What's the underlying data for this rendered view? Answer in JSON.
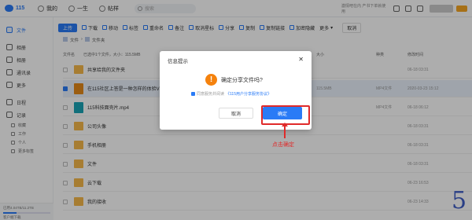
{
  "header": {
    "logo_text": "115",
    "nav": [
      "我的",
      "一生",
      "帖样"
    ],
    "search_placeholder": "搜索",
    "promo_text": "激情吧在内 产书下单就使用"
  },
  "sidebar": {
    "items": [
      {
        "label": "文件",
        "icon": "folder-icon",
        "active": true
      },
      {
        "label": "相册",
        "icon": "photo-icon"
      },
      {
        "label": "相册",
        "icon": "image-icon"
      },
      {
        "label": "通讯录",
        "icon": "contacts-icon"
      },
      {
        "label": "更多",
        "icon": "more-icon"
      },
      {
        "label": "日程",
        "icon": "calendar-icon"
      },
      {
        "label": "记录",
        "icon": "note-icon"
      }
    ],
    "subs": [
      "收藏",
      "工作",
      "个人",
      "更多标签"
    ],
    "footer_storage": "已用4.04TB/11.2TB",
    "footer_link": "客户端下载"
  },
  "toolbar": {
    "upload": "上传",
    "actions": [
      "下载",
      "移动",
      "标签",
      "重命名",
      "备注",
      "取消星标",
      "分享",
      "复制",
      "复制链接",
      "加密隐藏",
      "更多"
    ],
    "cancel": "取消"
  },
  "breadcrumb": {
    "root": "文件",
    "current": "文件夹"
  },
  "table": {
    "headers": {
      "name": "文件名",
      "selected": "已选中1个文件，大小：115.5MB",
      "size": "大小",
      "type": "种类",
      "time": "修改时间"
    },
    "rows": [
      {
        "name": "共享给我的文件夹",
        "kind": "folder",
        "size": "",
        "type": "",
        "time": "06-18 03:31"
      },
      {
        "name": "在115社区上答是一种怎样的体验V2.0",
        "kind": "video",
        "size": "115.5MB",
        "type": "MP4文件",
        "time": "2020-03-23 15:12",
        "selected": true
      },
      {
        "name": "115科技面壳片.mp4",
        "kind": "app",
        "size": "",
        "type": "MP4文件",
        "time": "06-18 06:12"
      },
      {
        "name": "公司头像",
        "kind": "folder",
        "size": "",
        "type": "",
        "time": "06-18 03:31"
      },
      {
        "name": "手机相册",
        "kind": "folder",
        "size": "",
        "type": "",
        "time": "06-18 03:31"
      },
      {
        "name": "文件",
        "kind": "folder",
        "size": "",
        "type": "",
        "time": "06-18 03:31"
      },
      {
        "name": "云下载",
        "kind": "folder",
        "size": "",
        "type": "",
        "time": "06-23 16:53"
      },
      {
        "name": "我的接收",
        "kind": "folder",
        "size": "",
        "type": "",
        "time": "06-23 14:33"
      }
    ]
  },
  "dialog": {
    "title": "信息提示",
    "question": "确定分享文件吗?",
    "agree_prefix": "同意服务并阅读",
    "agree_link": "《115用户分享服务协议》",
    "cancel": "取消",
    "confirm": "确定"
  },
  "annotation": {
    "label": "点击确定",
    "color": "#e02a2a"
  },
  "corner_number": "5",
  "colors": {
    "accent": "#2a7bf6",
    "warning": "#f5820d",
    "highlight": "#e02a2a"
  }
}
